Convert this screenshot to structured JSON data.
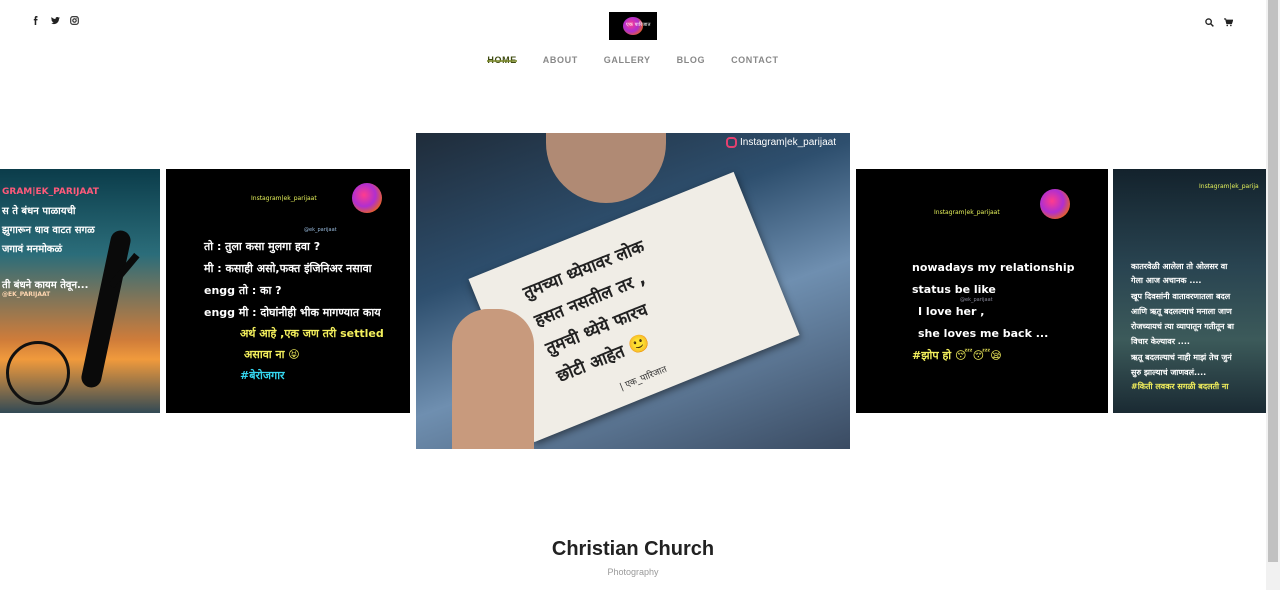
{
  "header": {
    "social_icons": [
      "facebook-icon",
      "twitter-icon",
      "instagram-icon"
    ],
    "logo_text": "एक पारिजात",
    "right_icons": [
      "search-icon",
      "cart-icon"
    ]
  },
  "nav": {
    "items": [
      {
        "label": "HOME",
        "active": true
      },
      {
        "label": "ABOUT",
        "active": false
      },
      {
        "label": "GALLERY",
        "active": false
      },
      {
        "label": "BLOG",
        "active": false
      },
      {
        "label": "CONTACT",
        "active": false
      }
    ],
    "active_color": "#7c8a2c"
  },
  "gallery": {
    "card1": {
      "lines": [
        "GRAM|EK_PARIJAAT",
        "स ते बंधन पाळायची",
        "झुगारून धाव वाटत सगळ",
        "जगावं मनमोकळं",
        "ती बंधने कायम तेवून...",
        "@EK_PARIJAAT"
      ]
    },
    "card2": {
      "handle": "Instagram|ek_parijaat",
      "small_handle": "@ek_parijaat",
      "lines": [
        "तो : तुला कसा मुलगा हवा ?",
        "मी : कसाही असो,फक्त इंजिनिअर नसावा",
        "engg तो : का ?",
        "engg मी : दोघांनीही भीक मागण्यात काय",
        "अर्थ आहे ,एक जण तरी settled",
        "असावा ना 😝",
        "#बेरोजगार"
      ]
    },
    "card3": {
      "handle": "Instagram|ek_parijaat",
      "lines": [
        "तुमच्या ध्येयावर लोक",
        "हसत नसतील तर ,",
        "तुमची ध्येये फारच",
        "छोटी आहेत 🙂"
      ],
      "signature": "| एक_पारिजात"
    },
    "card4": {
      "handle": "Instagram|ek_parijaat",
      "small_handle": "@ek_parijaat",
      "lines": [
        "nowadays my relationship",
        "status be like",
        "I love her ,",
        "she loves me back ...",
        "#झोप हो 😴😴😪"
      ]
    },
    "card5": {
      "handle": "Instagram|ek_parija",
      "lines": [
        "कातरवेळी आलेला तो ओलसर वा",
        "गेला आज अचानक ....",
        "खूप दिवसांनी वातावरणातला बदल",
        "आणि ऋतू बदलल्याचं मनाला जाण",
        "रोजच्यायचं त्या व्यापातून गतीतून बा",
        "विचार केल्यावर ....",
        "ऋतू बदलल्याचं नाही माझं तेच जुनं",
        "सुरु झाल्याचं जाणवलं....",
        "#किती लवकर सगळी बदलती ना"
      ]
    }
  },
  "caption": {
    "title": "Christian Church",
    "subtitle": "Photography"
  }
}
